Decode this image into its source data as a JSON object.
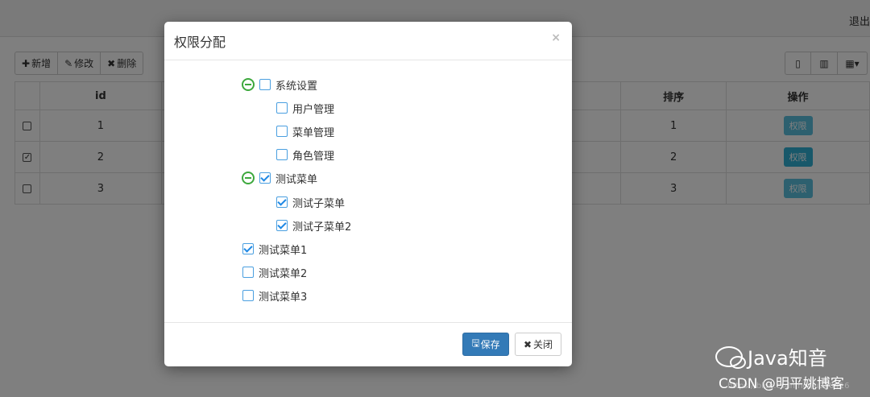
{
  "header": {
    "logout": "退出"
  },
  "toolbar": {
    "add": "新增",
    "edit": "修改",
    "delete": "删除"
  },
  "table": {
    "columns": {
      "id": "id",
      "sort": "排序",
      "action": "操作"
    },
    "rows": [
      {
        "checked": false,
        "id": "1",
        "sort": "1",
        "action": "权限"
      },
      {
        "checked": true,
        "id": "2",
        "sort": "2",
        "action": "权限"
      },
      {
        "checked": false,
        "id": "3",
        "sort": "3",
        "action": "权限"
      }
    ]
  },
  "modal": {
    "title": "权限分配",
    "close": "×",
    "save": "保存",
    "cancel": "关闭",
    "tree": [
      {
        "label": "系统设置",
        "checked": false,
        "expanded": true
      },
      {
        "label": "用户管理",
        "checked": false
      },
      {
        "label": "菜单管理",
        "checked": false
      },
      {
        "label": "角色管理",
        "checked": false
      },
      {
        "label": "测试菜单",
        "checked": true,
        "expanded": true
      },
      {
        "label": "测试子菜单",
        "checked": true
      },
      {
        "label": "测试子菜单2",
        "checked": true
      },
      {
        "label": "测试菜单1",
        "checked": true
      },
      {
        "label": "测试菜单2",
        "checked": false
      },
      {
        "label": "测试菜单3",
        "checked": false
      }
    ]
  },
  "watermark": {
    "brand": "Java知音",
    "csdn": "CSDN @明平姚博客",
    "url": "https://blog.csdn.net/u010416"
  },
  "colors": {
    "primary": "#337ab7",
    "info": "#5bc0de",
    "tree_toggle": "#3da83d",
    "checkbox": "#1e88e5"
  }
}
